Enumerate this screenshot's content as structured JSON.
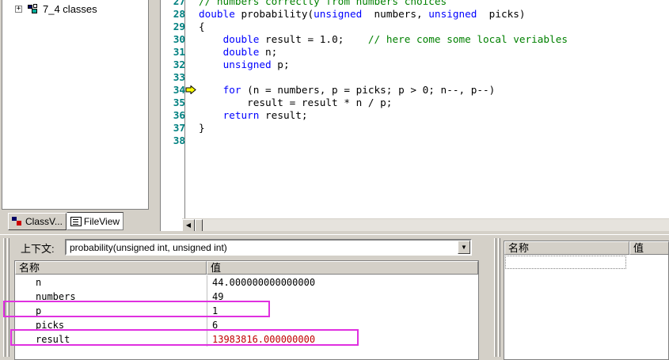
{
  "workspace": {
    "tree_items": [
      {
        "label": "7_4 classes",
        "expander": "+",
        "icon": "classes-folder-icon"
      }
    ],
    "tabs": [
      {
        "label": "ClassV...",
        "icon": "class-view-icon",
        "active": false
      },
      {
        "label": "FileView",
        "icon": "file-view-icon",
        "active": true
      }
    ]
  },
  "editor": {
    "current_line": 34,
    "lines": [
      {
        "n": "27",
        "segments": [
          {
            "t": "// numbers correctly from numbers choices",
            "c": "cm"
          }
        ]
      },
      {
        "n": "28",
        "segments": [
          {
            "t": "double",
            "c": "kw"
          },
          {
            "t": " probability(",
            "c": ""
          },
          {
            "t": "unsigned",
            "c": "kw"
          },
          {
            "t": "  numbers, ",
            "c": ""
          },
          {
            "t": "unsigned",
            "c": "kw"
          },
          {
            "t": "  picks)",
            "c": ""
          }
        ]
      },
      {
        "n": "29",
        "segments": [
          {
            "t": "{",
            "c": ""
          }
        ]
      },
      {
        "n": "30",
        "segments": [
          {
            "t": "    ",
            "c": ""
          },
          {
            "t": "double",
            "c": "kw"
          },
          {
            "t": " result = 1.0;    ",
            "c": ""
          },
          {
            "t": "// here come some local veriables",
            "c": "cm"
          }
        ]
      },
      {
        "n": "31",
        "segments": [
          {
            "t": "    ",
            "c": ""
          },
          {
            "t": "double",
            "c": "kw"
          },
          {
            "t": " n;",
            "c": ""
          }
        ]
      },
      {
        "n": "32",
        "segments": [
          {
            "t": "    ",
            "c": ""
          },
          {
            "t": "unsigned",
            "c": "kw"
          },
          {
            "t": " p;",
            "c": ""
          }
        ]
      },
      {
        "n": "33",
        "segments": []
      },
      {
        "n": "34",
        "segments": [
          {
            "t": "    ",
            "c": ""
          },
          {
            "t": "for",
            "c": "kw"
          },
          {
            "t": " (n = numbers, p = picks; p > 0; n--, p--)",
            "c": ""
          }
        ]
      },
      {
        "n": "35",
        "segments": [
          {
            "t": "        result = result * n / p;",
            "c": ""
          }
        ]
      },
      {
        "n": "36",
        "segments": [
          {
            "t": "    ",
            "c": ""
          },
          {
            "t": "return",
            "c": "kw"
          },
          {
            "t": " result;",
            "c": ""
          }
        ]
      },
      {
        "n": "37",
        "segments": [
          {
            "t": "}",
            "c": ""
          }
        ]
      },
      {
        "n": "38",
        "segments": []
      }
    ]
  },
  "variables": {
    "context_label": "上下文:",
    "context_value": "probability(unsigned int, unsigned int)",
    "headers": {
      "name": "名称",
      "value": "值"
    },
    "rows": [
      {
        "name": "n",
        "value": "44.000000000000000",
        "changed": false,
        "highlighted": false
      },
      {
        "name": "numbers",
        "value": "49",
        "changed": false,
        "highlighted": false
      },
      {
        "name": "p",
        "value": "1",
        "changed": false,
        "highlighted": true
      },
      {
        "name": "picks",
        "value": "6",
        "changed": false,
        "highlighted": false
      },
      {
        "name": "result",
        "value": "13983816.000000000",
        "changed": true,
        "highlighted": true
      }
    ],
    "highlight_color": "#e030e0",
    "changed_color": "#c00000"
  },
  "watch": {
    "headers": {
      "name": "名称",
      "value": "值"
    }
  }
}
